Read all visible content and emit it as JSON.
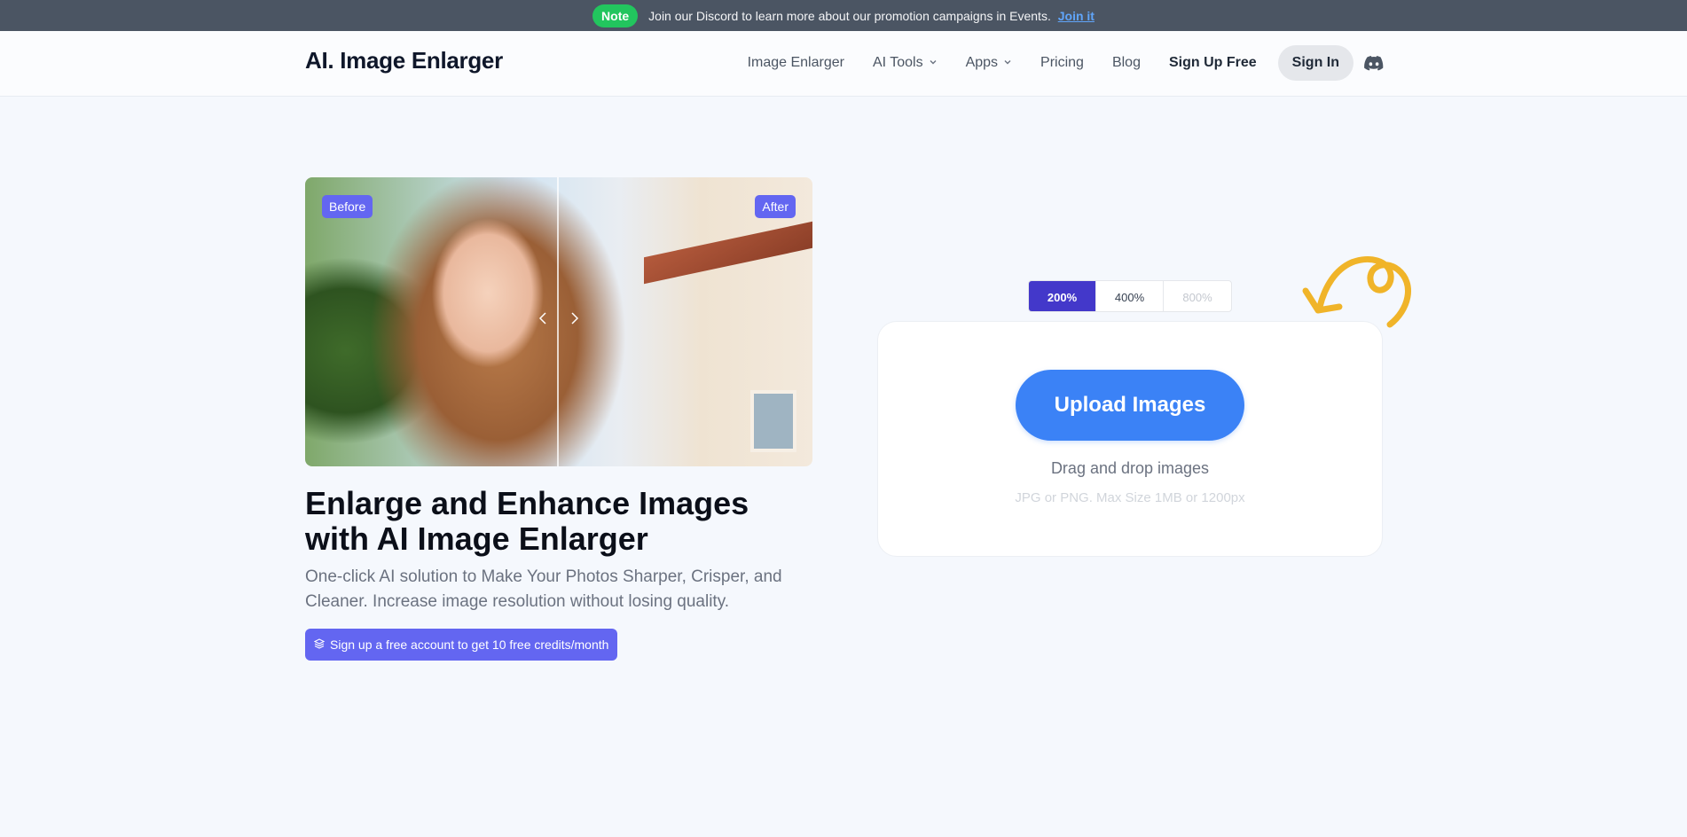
{
  "announcement": {
    "badge": "Note",
    "message": "Join our Discord to learn more about our promotion campaigns in Events.",
    "link": "Join it"
  },
  "header": {
    "logo": "AI. Image Enlarger",
    "nav": [
      {
        "label": "Image Enlarger"
      },
      {
        "label": "AI Tools"
      },
      {
        "label": "Apps"
      },
      {
        "label": "Pricing"
      },
      {
        "label": "Blog"
      },
      {
        "label": "Sign Up Free"
      }
    ],
    "sign_in": "Sign In"
  },
  "compare": {
    "before_label": "Before",
    "after_label": "After"
  },
  "hero": {
    "headline": "Enlarge and Enhance Images with AI Image Enlarger",
    "subtitle": "One-click AI solution to Make Your Photos Sharper, Crisper, and Cleaner. Increase image resolution without losing quality.",
    "credits_button": "Sign up a free account to get 10 free credits/month"
  },
  "scales": {
    "options": [
      "200%",
      "400%",
      "800%"
    ],
    "selected": "200%"
  },
  "upload": {
    "button": "Upload Images",
    "drag_text": "Drag and drop images",
    "hint": "JPG or PNG. Max Size 1MB or 1200px"
  },
  "colors": {
    "accent": "#3b82f6",
    "indigo": "#6366f1",
    "active_scale": "#4338ca",
    "note_green": "#22c55e",
    "topbar": "#4b5563",
    "doodle": "#f0b429"
  }
}
